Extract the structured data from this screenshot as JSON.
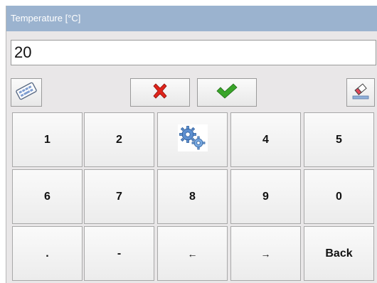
{
  "dialog": {
    "title": "Temperature [°C]"
  },
  "input": {
    "value": "20"
  },
  "toolbar": {
    "keyboard_icon": "keyboard-icon",
    "cancel_icon": "red-x-icon",
    "confirm_icon": "green-check-icon",
    "clear_icon": "eraser-icon"
  },
  "keypad": {
    "row1": [
      "1",
      "2",
      "",
      "4",
      "5"
    ],
    "row2": [
      "6",
      "7",
      "8",
      "9",
      "0"
    ],
    "row3": [
      ".",
      "-",
      "←",
      "→",
      "Back"
    ],
    "settings_icon": "gears-icon"
  },
  "colors": {
    "title_bar": "#9bb3cf",
    "cancel": "#e0241b",
    "confirm": "#3aa52a"
  }
}
